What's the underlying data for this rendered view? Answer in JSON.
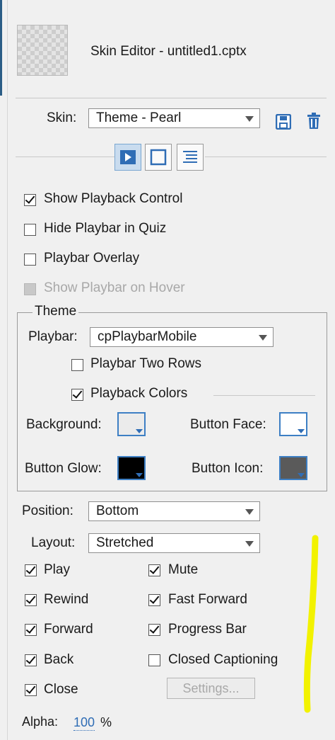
{
  "header": {
    "title": "Skin Editor - untitled1.cptx"
  },
  "skin": {
    "label": "Skin:",
    "value": "Theme - Pearl"
  },
  "tabs": [
    "playback",
    "borders",
    "table-of-contents"
  ],
  "options": {
    "show_playback_control": {
      "label": "Show Playback Control",
      "checked": true
    },
    "hide_playbar_in_quiz": {
      "label": "Hide Playbar in Quiz",
      "checked": false
    },
    "playbar_overlay": {
      "label": "Playbar Overlay",
      "checked": false
    },
    "show_playbar_on_hover": {
      "label": "Show Playbar on Hover",
      "checked": false,
      "disabled": true
    }
  },
  "theme": {
    "legend": "Theme",
    "playbar_label": "Playbar:",
    "playbar_value": "cpPlaybarMobile",
    "two_rows": {
      "label": "Playbar Two Rows",
      "checked": false
    },
    "playback_colors": {
      "label": "Playback Colors",
      "checked": true
    },
    "colors": {
      "background": {
        "label": "Background:",
        "color": "#ebebeb"
      },
      "button_face": {
        "label": "Button Face:",
        "color": "#ffffff"
      },
      "button_glow": {
        "label": "Button Glow:",
        "color": "#000000"
      },
      "button_icon": {
        "label": "Button Icon:",
        "color": "#5a5a5a"
      }
    }
  },
  "position": {
    "label": "Position:",
    "value": "Bottom"
  },
  "layout": {
    "label": "Layout:",
    "value": "Stretched"
  },
  "controls": {
    "play": {
      "label": "Play",
      "checked": true
    },
    "mute": {
      "label": "Mute",
      "checked": true
    },
    "rewind": {
      "label": "Rewind",
      "checked": true
    },
    "fast_forward": {
      "label": "Fast Forward",
      "checked": true
    },
    "forward": {
      "label": "Forward",
      "checked": true
    },
    "progress_bar": {
      "label": "Progress Bar",
      "checked": true
    },
    "back": {
      "label": "Back",
      "checked": true
    },
    "closed_captioning": {
      "label": "Closed Captioning",
      "checked": false
    },
    "close": {
      "label": "Close",
      "checked": true
    }
  },
  "settings_button": "Settings...",
  "alpha": {
    "label": "Alpha:",
    "value": "100",
    "unit": "%"
  },
  "accent_color": "#2f6db5",
  "annotation_color": "#f2f200"
}
